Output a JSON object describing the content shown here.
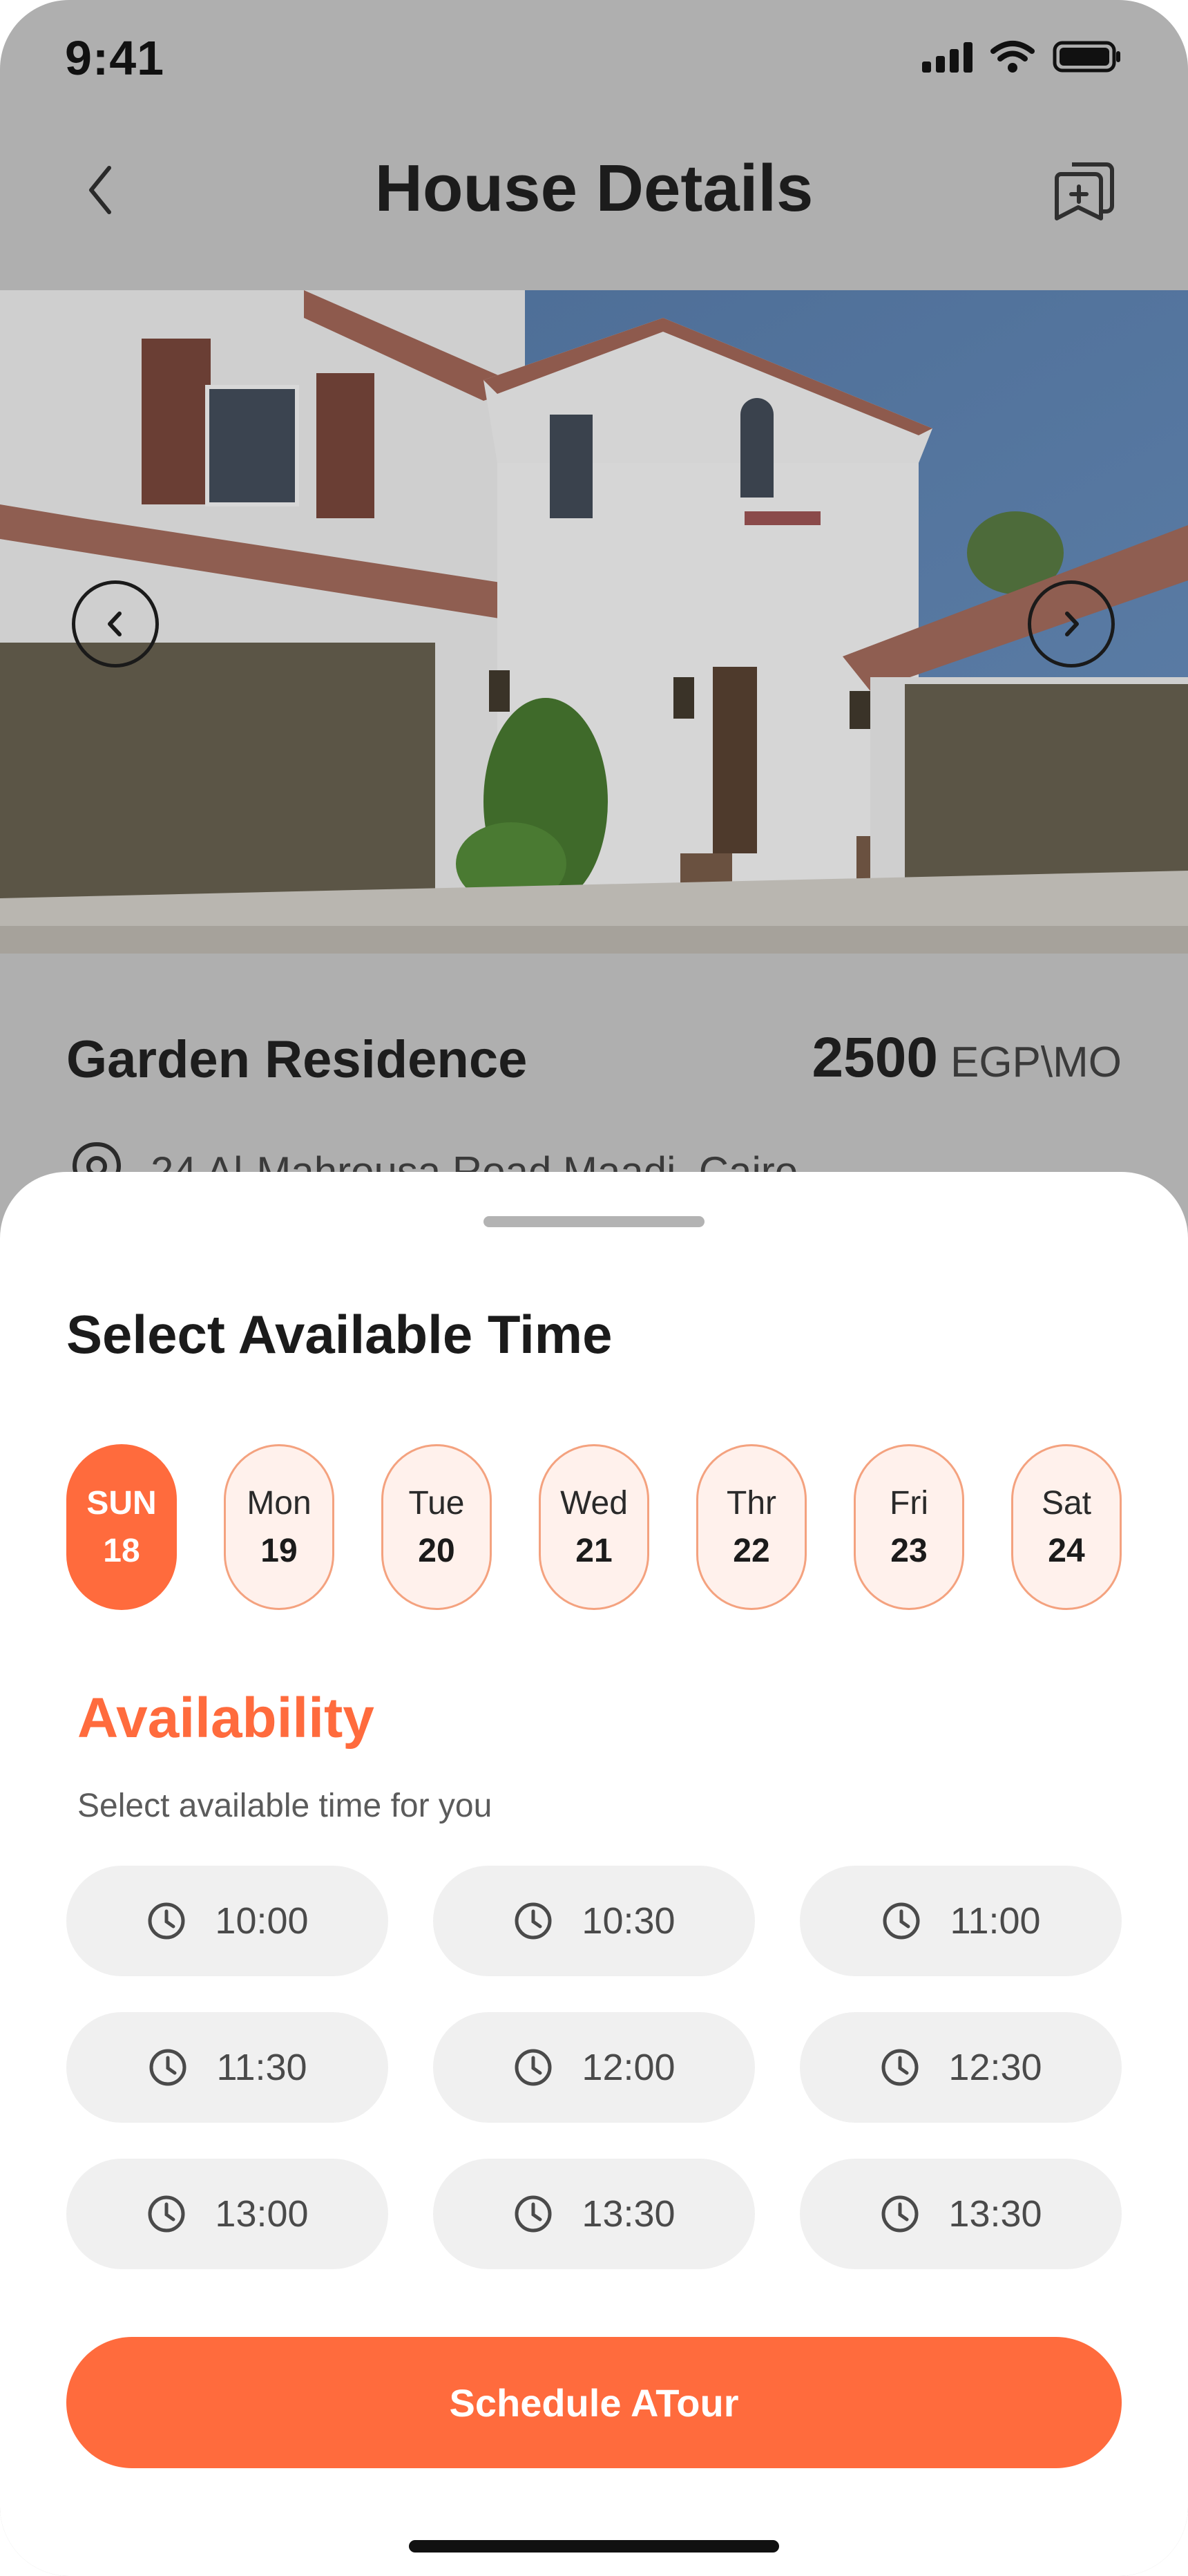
{
  "status_bar": {
    "time": "9:41"
  },
  "header": {
    "title": "House Details",
    "back_icon": "chevron-left-icon",
    "share_icon": "bookmark-add-icon"
  },
  "listing": {
    "name": "Garden Residence",
    "price": "2500",
    "price_unit": "EGP\\MO",
    "address": "24 Al-Mahrousa Road Maadi, Cairo"
  },
  "sheet": {
    "title": "Select Available Time",
    "days": [
      {
        "name": "SUN",
        "num": "18",
        "selected": true
      },
      {
        "name": "Mon",
        "num": "19",
        "selected": false
      },
      {
        "name": "Tue",
        "num": "20",
        "selected": false
      },
      {
        "name": "Wed",
        "num": "21",
        "selected": false
      },
      {
        "name": "Thr",
        "num": "22",
        "selected": false
      },
      {
        "name": "Fri",
        "num": "23",
        "selected": false
      },
      {
        "name": "Sat",
        "num": "24",
        "selected": false
      }
    ],
    "availability_title": "Availability",
    "availability_subtitle": "Select available time for you",
    "slots": [
      "10:00",
      "10:30",
      "11:00",
      "11:30",
      "12:00",
      "12:30",
      "13:00",
      "13:30",
      "13:30"
    ],
    "cta_label": "Schedule ATour"
  },
  "colors": {
    "accent": "#ff6b3d",
    "accent_light": "#fff1ec",
    "slot_bg": "#f0f0f0",
    "backdrop": "#afafaf"
  }
}
